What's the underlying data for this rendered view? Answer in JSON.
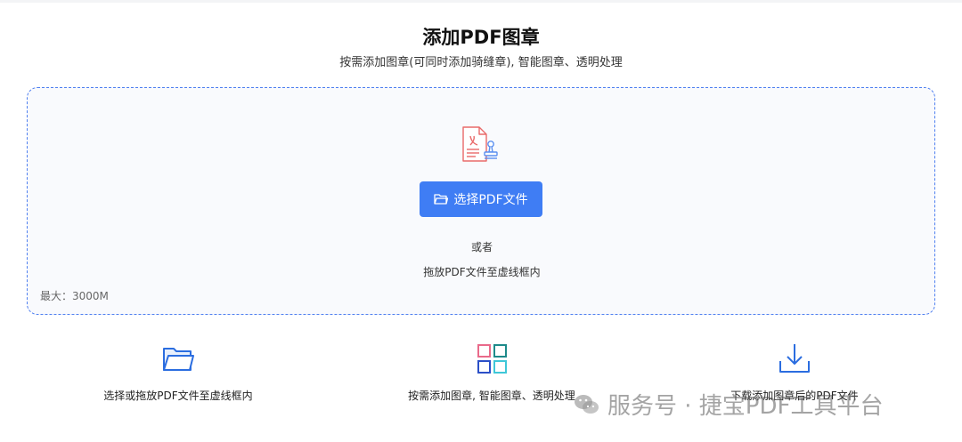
{
  "header": {
    "title": "添加PDF图章",
    "subtitle": "按需添加图章(可同时添加骑缝章), 智能图章、透明处理"
  },
  "dropzone": {
    "file_icon": "pdf-stamp-icon",
    "button_icon": "folder-open-icon",
    "button_label": "选择PDF文件",
    "or_text": "或者",
    "drag_text": "拖放PDF文件至虚线框内",
    "max_size": "最大：3000M"
  },
  "features": [
    {
      "icon": "folder-icon",
      "label": "选择或拖放PDF文件至虚线框内"
    },
    {
      "icon": "grid-icon",
      "label": "按需添加图章, 智能图章、透明处理"
    },
    {
      "icon": "download-icon",
      "label": "下载添加图章后的PDF文件"
    }
  ],
  "watermark": {
    "icon": "wechat-icon",
    "text": "服务号 · 捷宝PDF工具平台"
  },
  "colors": {
    "accent": "#3f7df4",
    "dropzone_border": "#4e7ff0",
    "dropzone_bg": "#f9fafd",
    "icon_red": "#e96a6a"
  }
}
